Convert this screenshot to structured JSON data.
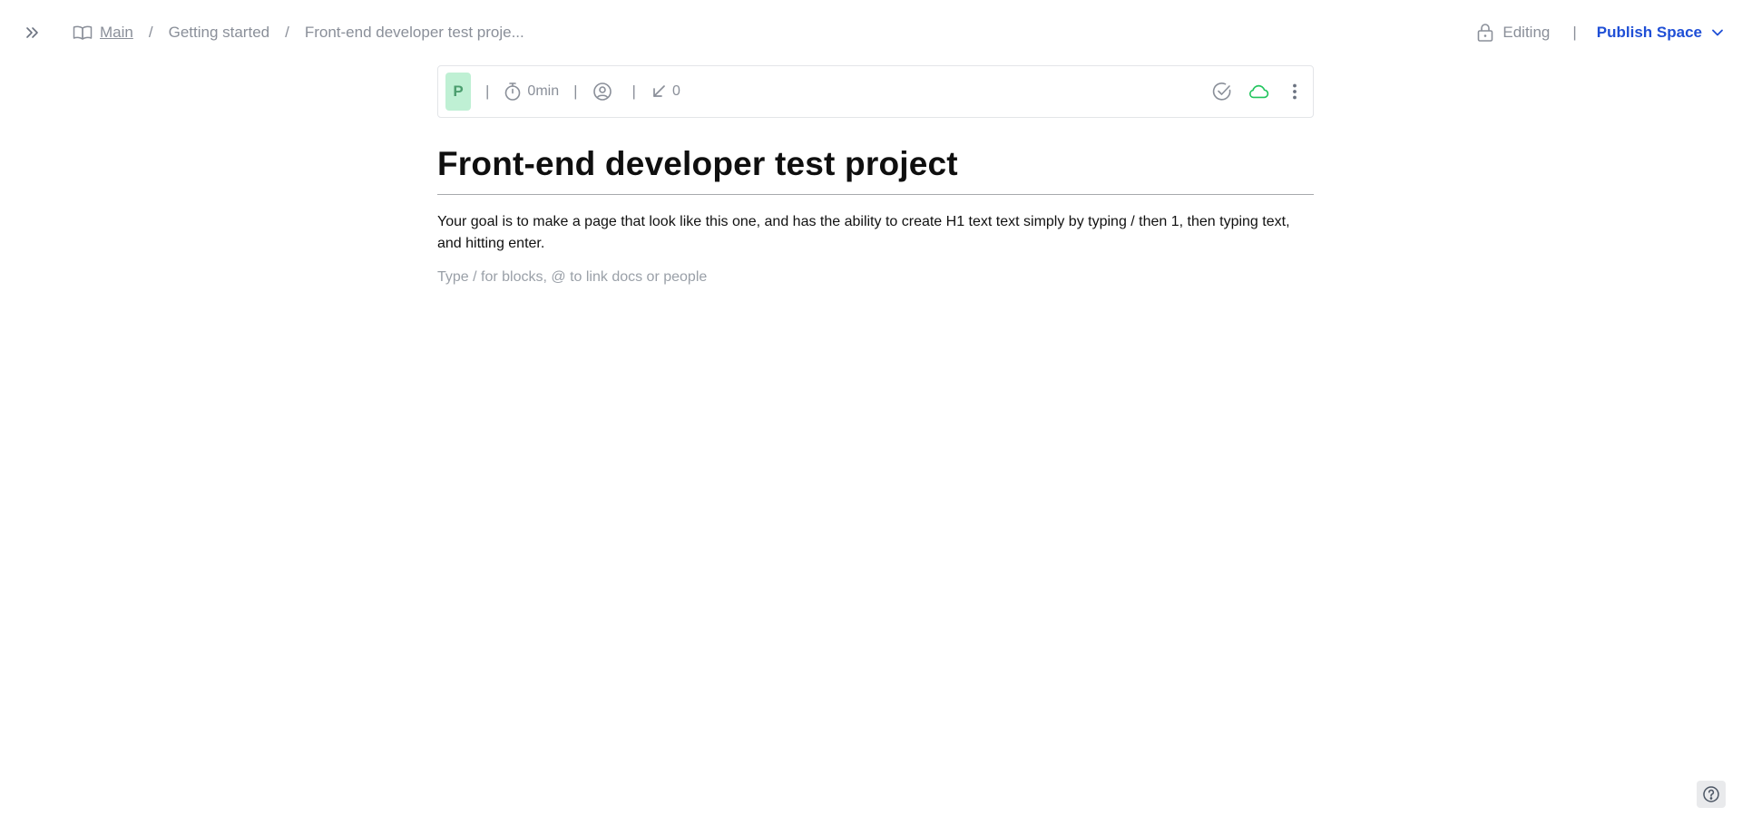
{
  "breadcrumb": {
    "items": [
      "Main",
      "Getting started",
      "Front-end developer test proje..."
    ],
    "separator": "/"
  },
  "header": {
    "editing_label": "Editing",
    "separator": "|",
    "publish_label": "Publish Space"
  },
  "toolbar": {
    "avatar_letter": "P",
    "separator": "|",
    "reading_time": "0min",
    "backlinks_count": "0"
  },
  "document": {
    "title": "Front-end developer test project",
    "paragraph": "Your goal is to make a page that look like this one, and has the ability to create H1 text text simply by typing / then 1, then typing text, and hitting enter.",
    "placeholder": "Type / for blocks, @ to link docs or people"
  },
  "icons": {
    "expand": "double-chevron-right-icon",
    "book": "book-open-icon",
    "lock": "lock-icon",
    "chevron": "chevron-down-icon",
    "timer": "stopwatch-icon",
    "user": "user-circle-icon",
    "arrow": "arrow-down-left-icon",
    "check": "check-circle-icon",
    "cloud": "cloud-icon",
    "more": "more-vertical-icon",
    "help": "help-circle-icon"
  },
  "colors": {
    "accent": "#1f4fd6",
    "muted": "#8a8f99",
    "avatar_bg": "#bff0d4",
    "cloud_green": "#22c55e"
  }
}
